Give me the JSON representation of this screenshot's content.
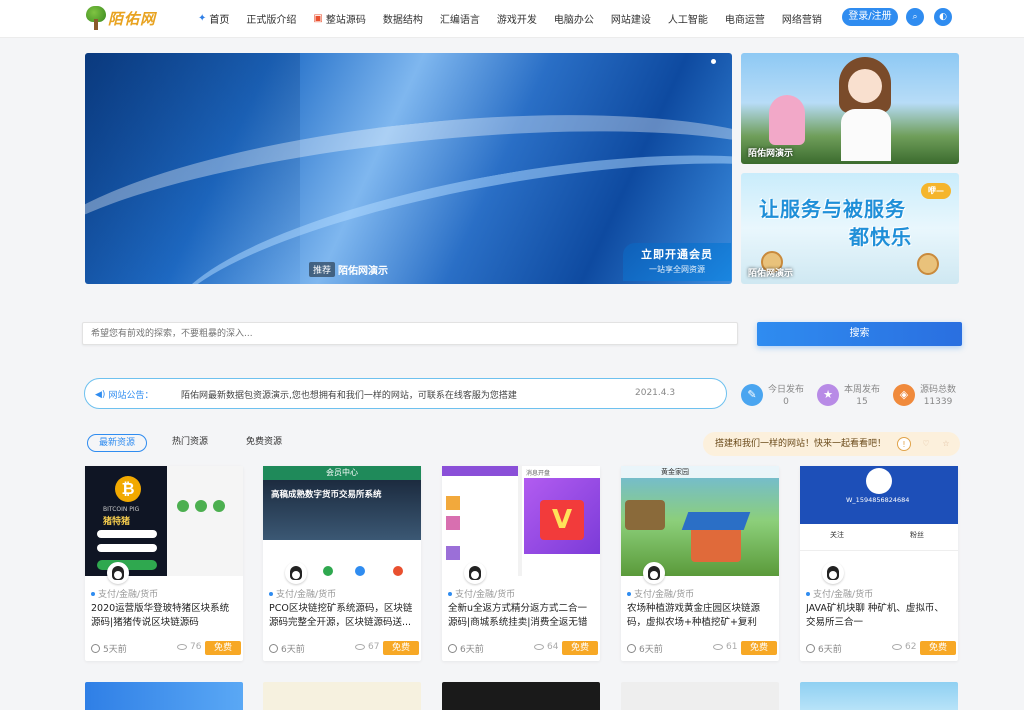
{
  "header": {
    "logo_text": "陌佑网",
    "nav": [
      {
        "label": "首页",
        "icon": "star-icon"
      },
      {
        "label": "正式版介绍"
      },
      {
        "label": "整站源码",
        "icon": "bag-icon"
      },
      {
        "label": "数据结构"
      },
      {
        "label": "汇编语言"
      },
      {
        "label": "游戏开发"
      },
      {
        "label": "电脑办公"
      },
      {
        "label": "网站建设"
      },
      {
        "label": "人工智能"
      },
      {
        "label": "电商运营"
      },
      {
        "label": "网络营销"
      }
    ],
    "login_label": "登录/注册"
  },
  "banner": {
    "tag": "推荐",
    "caption": "陌佑网演示",
    "vip_title": "立即开通会员",
    "vip_sub": "一站享全网资源"
  },
  "side_cards": [
    {
      "label": "陌佑网演示"
    },
    {
      "label": "陌佑网演示",
      "slogan_line1": "让服务与被服务",
      "slogan_line2": "都快乐",
      "badge": "咿—"
    }
  ],
  "search": {
    "placeholder": "希望您有前戏的探索，不要粗暴的深入...",
    "button_label": "搜索"
  },
  "notice": {
    "label": "网站公告：",
    "text": "陌佑网最新数据包资源演示,您也想拥有和我们一样的网站，可联系在线客服为您搭建",
    "date": "2021.4.3"
  },
  "stats": [
    {
      "title": "今日发布",
      "value": "0",
      "color": "#4aa5f0"
    },
    {
      "title": "本周发布",
      "value": "15",
      "color": "#b88be6"
    },
    {
      "title": "源码总数",
      "value": "11339",
      "color": "#f08a3c"
    }
  ],
  "tabs": [
    "最新资源",
    "热门资源",
    "免费资源"
  ],
  "tip": {
    "text": "搭建和我们一样的网站！快来一起看看吧！"
  },
  "cards": [
    {
      "category": "支付/金融/货币",
      "title": "2020运营版华登玻特猪区块系统源码|猪猪传说区块链源码",
      "time": "5天前",
      "views": "76",
      "badge": "免费"
    },
    {
      "category": "支付/金融/货币",
      "title": "PCO区块链挖矿系统源码，区块链源码完整全开源，区块链源码送...",
      "time": "6天前",
      "views": "67",
      "badge": "免费"
    },
    {
      "category": "支付/金融/货币",
      "title": "全新u全返方式精分返方式二合一源码|商城系统挂卖|消费全返无错版...",
      "time": "6天前",
      "views": "64",
      "badge": "免费"
    },
    {
      "category": "支付/金融/货币",
      "title": "农场种植游戏黄金庄园区块链源码，虚拟农场+种植挖矿+复利分...",
      "time": "6天前",
      "views": "61",
      "badge": "免费"
    },
    {
      "category": "支付/金融/货币",
      "title": "JAVA矿机块聊 种矿机、虚拟币、交易所三合一",
      "time": "6天前",
      "views": "62",
      "badge": "免费"
    }
  ],
  "card_thumbs": [
    {
      "text1": "BITCOIN PIG",
      "text2": "猪特猪"
    },
    {
      "text1": "会员中心",
      "text2": "高稿成熟数字货币交易所系统"
    },
    {
      "text1": "消息开盘"
    },
    {
      "text1": "黄金家园"
    },
    {
      "text1": "W_1594856824684",
      "text2": "关注",
      "text3": "粉丝"
    }
  ],
  "colors": {
    "accent": "#2f8cf0",
    "free_badge": "#f7a825"
  }
}
